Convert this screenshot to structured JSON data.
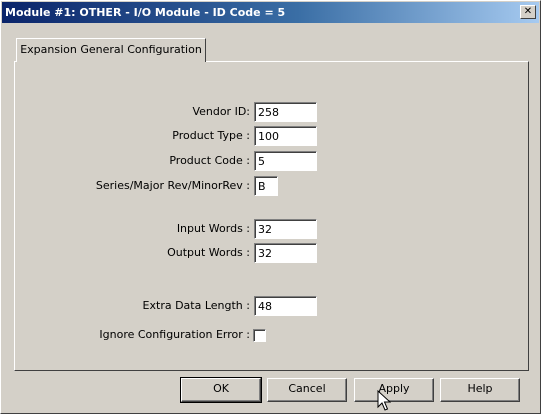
{
  "window": {
    "title": "Module #1: OTHER - I/O Module - ID Code = 5",
    "close_glyph": "✕"
  },
  "tabs": [
    {
      "label": "Expansion General Configuration",
      "active": true
    }
  ],
  "form": {
    "vendor_id": {
      "label": "Vendor ID:",
      "value": "258"
    },
    "product_type": {
      "label": "Product Type :",
      "value": "100"
    },
    "product_code": {
      "label": "Product Code :",
      "value": "5"
    },
    "series_rev": {
      "label": "Series/Major Rev/MinorRev :",
      "value": "B"
    },
    "input_words": {
      "label": "Input Words :",
      "value": "32"
    },
    "output_words": {
      "label": "Output Words :",
      "value": "32"
    },
    "extra_data_length": {
      "label": "Extra Data Length :",
      "value": "48"
    },
    "ignore_config_error": {
      "label": "Ignore Configuration Error :",
      "checked": false
    }
  },
  "buttons": {
    "ok": "OK",
    "cancel": "Cancel",
    "apply": "Apply",
    "help": "Help"
  },
  "icons": {
    "cursor": "arrow-pointer-icon"
  }
}
